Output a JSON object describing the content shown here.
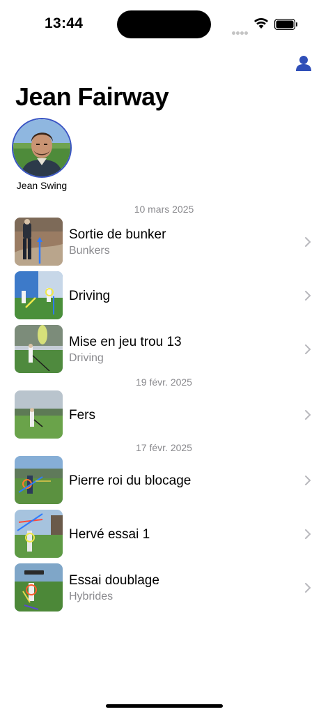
{
  "status_bar": {
    "time": "13:44"
  },
  "header": {
    "title": "Jean Fairway"
  },
  "profile": {
    "name": "Jean Swing"
  },
  "accent_color": "#2f4fb8",
  "groups": [
    {
      "date": "10 mars 2025",
      "items": [
        {
          "title": "Sortie de bunker",
          "subtitle": "Bunkers"
        },
        {
          "title": "Driving",
          "subtitle": ""
        },
        {
          "title": "Mise en jeu trou 13",
          "subtitle": "Driving"
        }
      ]
    },
    {
      "date": "19 févr. 2025",
      "items": [
        {
          "title": "Fers",
          "subtitle": ""
        }
      ]
    },
    {
      "date": "17 févr. 2025",
      "items": [
        {
          "title": "Pierre roi du blocage",
          "subtitle": ""
        },
        {
          "title": "Hervé essai 1",
          "subtitle": ""
        },
        {
          "title": "Essai doublage",
          "subtitle": "Hybrides"
        }
      ]
    }
  ]
}
